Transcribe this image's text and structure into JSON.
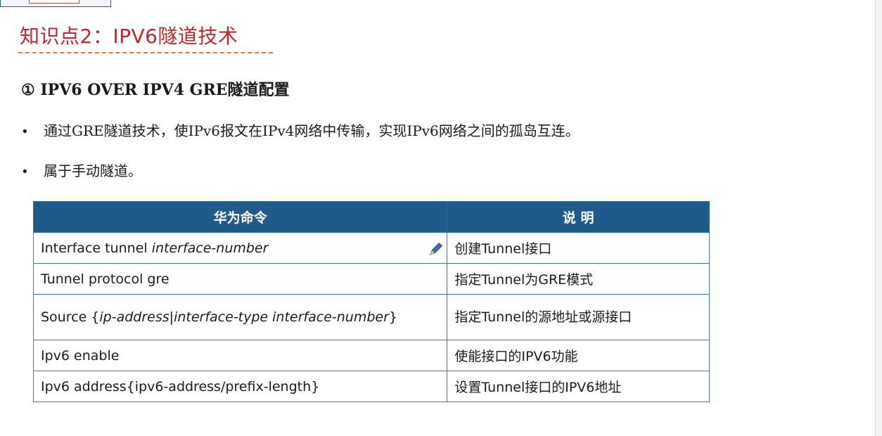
{
  "section": {
    "title": "知识点2：IPV6隧道技术"
  },
  "subheading": "① IPV6 OVER IPV4 GRE隧道配置",
  "bullets": [
    "通过GRE隧道技术，使IPv6报文在IPv4网络中传输，实现IPv6网络之间的孤岛互连。",
    "属于手动隧道。"
  ],
  "bullet_symbol": "•",
  "table": {
    "headers": [
      "华为命令",
      "说 明"
    ],
    "rows": [
      {
        "cmd_prefix": "Interface tunnel ",
        "cmd_param": "interface-number",
        "desc": "创建Tunnel接口"
      },
      {
        "cmd": "Tunnel protocol gre",
        "desc": "指定Tunnel为GRE模式"
      },
      {
        "cmd_prefix": "Source {",
        "cmd_param": "ip-address",
        "cmd_sep": "|",
        "cmd_param2": "interface-type interface-number",
        "cmd_suffix": "}",
        "desc": "指定Tunnel的源地址或源接口"
      },
      {
        "cmd": "Ipv6 enable",
        "desc": "使能接口的IPV6功能"
      },
      {
        "cmd": "Ipv6 address{ipv6-address/prefix-length}",
        "desc": "设置Tunnel接口的IPV6地址"
      }
    ]
  },
  "icons": {
    "pencil": "pencil-icon"
  },
  "colors": {
    "title": "#c0282d",
    "underline": "#e07b39",
    "header_bg": "#1f5a8a",
    "border": "#3a79b8"
  }
}
